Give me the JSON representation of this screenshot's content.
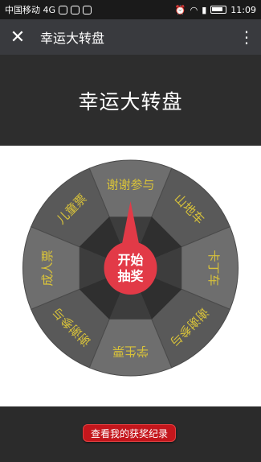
{
  "status_bar": {
    "carrier": "中国移动 4G",
    "time": "11:09"
  },
  "top_bar": {
    "title": "幸运大转盘",
    "close_icon": "close-icon",
    "more_icon": "more-vertical-icon"
  },
  "header": {
    "title": "幸运大转盘"
  },
  "wheel": {
    "prizes": [
      "谢谢参与",
      "山地车",
      "卡丁车",
      "谢谢参与",
      "学生票",
      "谢谢参与",
      "成人票",
      "儿童票"
    ],
    "center_label_line1": "开始",
    "center_label_line2": "抽奖",
    "colors": {
      "outer_dark": "#595959",
      "outer_light": "#6e6e6e",
      "inner_dark": "#2f2f2f",
      "inner_light": "#3d3d3d",
      "text": "#d8c23a",
      "pointer": "#e23a47"
    }
  },
  "footer": {
    "record_button": "查看我的获奖纪录"
  }
}
